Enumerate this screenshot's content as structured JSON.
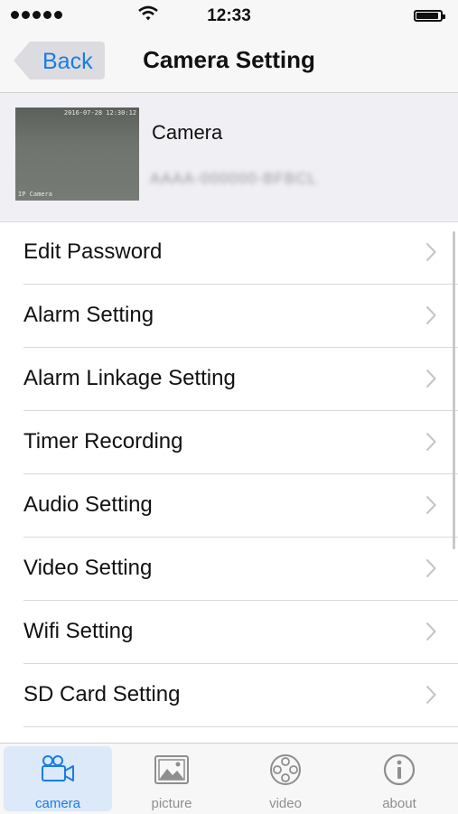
{
  "status_bar": {
    "time": "12:33"
  },
  "nav": {
    "back_label": "Back",
    "title": "Camera Setting"
  },
  "camera": {
    "name": "Camera",
    "id": "AAAA-000000-BFBCL",
    "thumbnail": {
      "timestamp": "2016-07-28 12:30:12",
      "caption": "IP Camera"
    }
  },
  "menu": {
    "items": [
      {
        "label": "Edit Password"
      },
      {
        "label": "Alarm Setting"
      },
      {
        "label": "Alarm Linkage Setting"
      },
      {
        "label": "Timer Recording"
      },
      {
        "label": "Audio Setting"
      },
      {
        "label": "Video Setting"
      },
      {
        "label": "Wifi Setting"
      },
      {
        "label": "SD Card Setting"
      }
    ]
  },
  "tabbar": {
    "tabs": [
      {
        "label": "camera",
        "icon": "video-camera-icon",
        "active": true
      },
      {
        "label": "picture",
        "icon": "picture-icon",
        "active": false
      },
      {
        "label": "video",
        "icon": "film-reel-icon",
        "active": false
      },
      {
        "label": "about",
        "icon": "info-icon",
        "active": false
      }
    ]
  },
  "colors": {
    "accent": "#1a7ce6",
    "inactive": "#8e8e8e",
    "active_tab_bg": "#dbe9f8"
  }
}
